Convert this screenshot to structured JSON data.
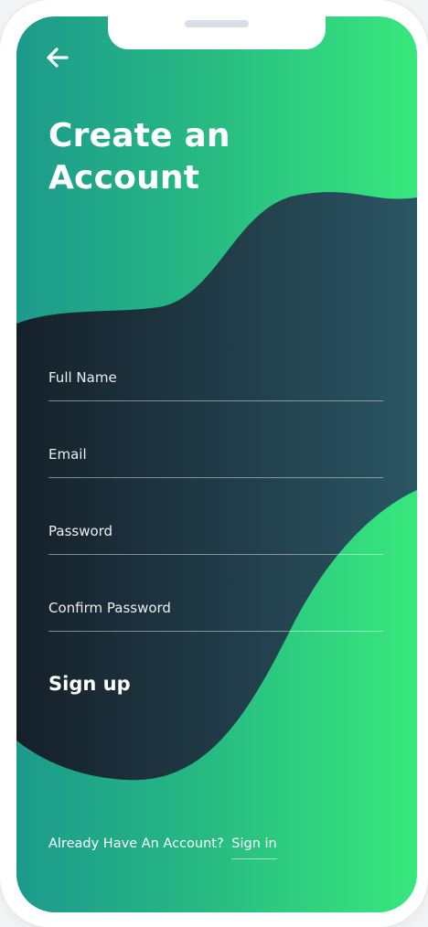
{
  "header": {
    "back_icon": "arrow-left-icon",
    "title_line1": "Create an",
    "title_line2": "Account"
  },
  "form": {
    "full_name": {
      "placeholder": "Full Name",
      "value": ""
    },
    "email": {
      "placeholder": "Email",
      "value": ""
    },
    "password": {
      "placeholder": "Password",
      "value": ""
    },
    "confirm_password": {
      "placeholder": "Confirm Password",
      "value": ""
    }
  },
  "actions": {
    "signup_label": "Sign up"
  },
  "footer": {
    "prompt": "Already Have An Account?",
    "signin_label": "Sign in"
  },
  "colors": {
    "gradient_start": "#1c9a8c",
    "gradient_end": "#38e87c",
    "wave_start": "#152029",
    "wave_end": "#2b5564",
    "text": "#ffffff"
  }
}
